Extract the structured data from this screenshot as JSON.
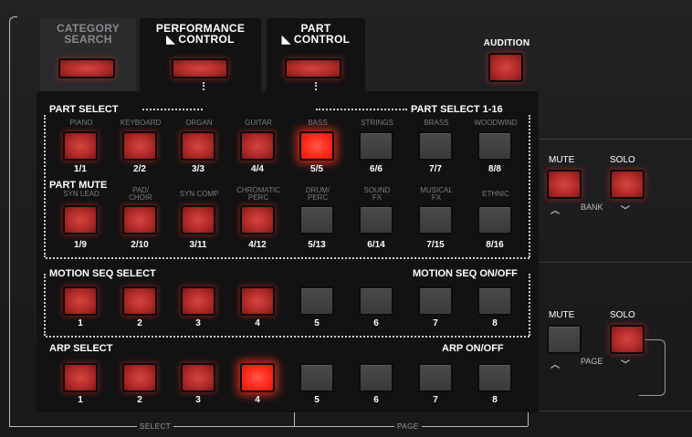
{
  "tabs": {
    "category_search": [
      "CATEGORY",
      "SEARCH"
    ],
    "performance_control": [
      "PERFORMANCE",
      "◣ CONTROL"
    ],
    "part_control": [
      "PART",
      "◣ CONTROL"
    ],
    "audition": "AUDITION"
  },
  "sections": {
    "part_select": "PART SELECT",
    "part_select_range": "PART SELECT 1-16",
    "part_mute": "PART MUTE",
    "motion_seq_select": "MOTION SEQ SELECT",
    "motion_seq_onoff": "MOTION SEQ ON/OFF",
    "arp_select": "ARP SELECT",
    "arp_onoff": "ARP ON/OFF"
  },
  "part_row1_top": [
    "PIANO",
    "KEYBOARD",
    "ORGAN",
    "GUITAR",
    "BASS",
    "STRINGS",
    "BRASS",
    "WOODWIND"
  ],
  "part_row1_nums": [
    "1/1",
    "2/2",
    "3/3",
    "4/4",
    "5/5",
    "6/6",
    "7/7",
    "8/8"
  ],
  "part_row1_states": [
    "red",
    "red",
    "red",
    "red",
    "lit",
    "off",
    "off",
    "off"
  ],
  "part_row2_top": [
    [
      "SYN LEAD"
    ],
    [
      "PAD/",
      "CHOIR"
    ],
    [
      "SYN COMP"
    ],
    [
      "CHROMATIC",
      "PERC"
    ],
    [
      "DRUM/",
      "PERC"
    ],
    [
      "SOUND",
      "FX"
    ],
    [
      "MUSICAL",
      "FX"
    ],
    [
      "ETHNIC"
    ]
  ],
  "part_row2_nums": [
    "1/9",
    "2/10",
    "3/11",
    "4/12",
    "5/13",
    "6/14",
    "7/15",
    "8/16"
  ],
  "part_row2_states": [
    "red",
    "red",
    "red",
    "red",
    "off",
    "off",
    "off",
    "off"
  ],
  "motion_nums": [
    "1",
    "2",
    "3",
    "4",
    "5",
    "6",
    "7",
    "8"
  ],
  "motion_states": [
    "red",
    "red",
    "red",
    "red",
    "off",
    "off",
    "off",
    "off"
  ],
  "arp_nums": [
    "1",
    "2",
    "3",
    "4",
    "5",
    "6",
    "7",
    "8"
  ],
  "arp_states": [
    "red",
    "red",
    "red",
    "lit",
    "off",
    "off",
    "off",
    "off"
  ],
  "right_bank": {
    "mute": "MUTE",
    "solo": "SOLO",
    "label": "BANK",
    "mute_state": "red",
    "solo_state": "red"
  },
  "right_page": {
    "mute": "MUTE",
    "solo": "SOLO",
    "label": "PAGE",
    "mute_state": "off",
    "solo_state": "red"
  },
  "footer": {
    "select": "SELECT",
    "page": "PAGE"
  },
  "colors": {
    "lit": "#ff2a1c",
    "red": "#b12b29",
    "off": "#3a3a3c",
    "panel": "#1b1b1d"
  }
}
